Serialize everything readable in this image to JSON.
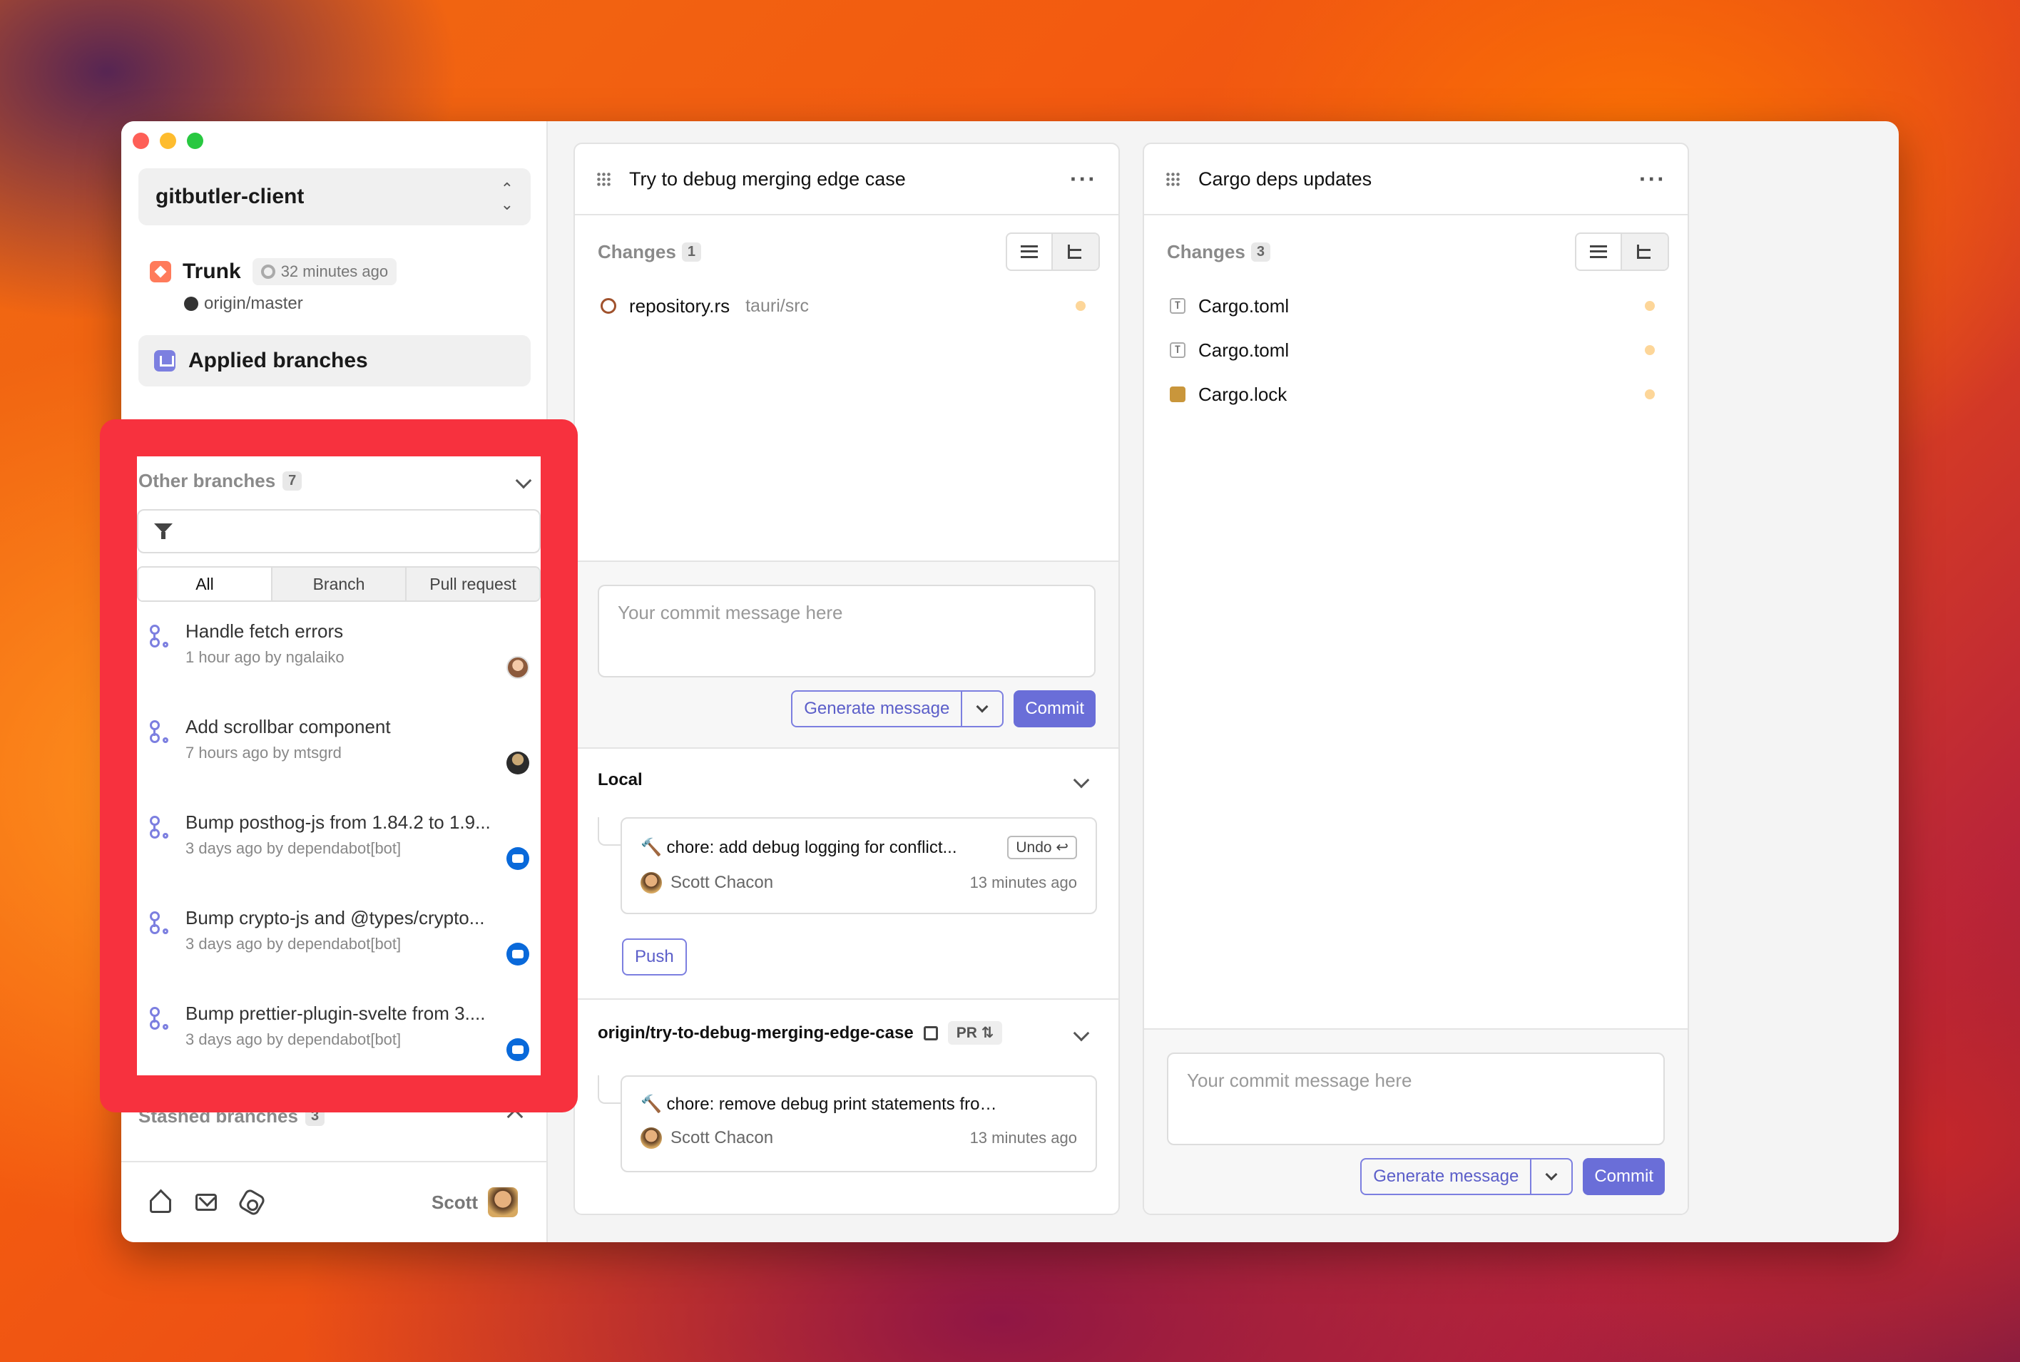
{
  "window": {
    "project_name": "gitbutler-client"
  },
  "sidebar": {
    "trunk": {
      "label": "Trunk",
      "time": "32 minutes ago",
      "remote": "origin/master"
    },
    "applied_label": "Applied branches",
    "other_branches": {
      "title": "Other branches",
      "count": "7",
      "filter_placeholder": "",
      "tabs": [
        "All",
        "Branch",
        "Pull request"
      ],
      "active_tab": "All",
      "items": [
        {
          "title": "Handle fetch errors",
          "subtitle": "1 hour ago by ngalaiko",
          "avatar": "person"
        },
        {
          "title": "Add scrollbar component",
          "subtitle": "7 hours ago by mtsgrd",
          "avatar": "dark"
        },
        {
          "title": "Bump posthog-js from 1.84.2 to 1.9...",
          "subtitle": "3 days ago by dependabot[bot]",
          "avatar": "bot"
        },
        {
          "title": "Bump crypto-js and @types/crypto...",
          "subtitle": "3 days ago by dependabot[bot]",
          "avatar": "bot"
        },
        {
          "title": "Bump prettier-plugin-svelte from 3....",
          "subtitle": "3 days ago by dependabot[bot]",
          "avatar": "bot"
        }
      ]
    },
    "stashed": {
      "title": "Stashed branches",
      "count": "3"
    },
    "footer": {
      "user_name": "Scott"
    }
  },
  "lanes": [
    {
      "title": "Try to debug merging edge case",
      "changes_label": "Changes",
      "changes_count": "1",
      "files": [
        {
          "name": "repository.rs",
          "path": "tauri/src",
          "icon": "rust"
        }
      ],
      "commit_placeholder": "Your commit message here",
      "generate_label": "Generate message",
      "commit_label": "Commit",
      "local": {
        "title": "Local",
        "commit_message": "🔨 chore: add debug logging for conflict...",
        "undo_label": "Undo ↩",
        "author": "Scott Chacon",
        "time": "13 minutes ago",
        "push_label": "Push"
      },
      "remote": {
        "title": "origin/try-to-debug-merging-edge-case",
        "pr_label": "PR ⇅",
        "commit_message": "🔨 chore: remove debug print statements from wor...",
        "author": "Scott Chacon",
        "time": "13 minutes ago"
      }
    },
    {
      "title": "Cargo deps updates",
      "changes_label": "Changes",
      "changes_count": "3",
      "files": [
        {
          "name": "Cargo.toml",
          "path": "",
          "icon": "toml"
        },
        {
          "name": "Cargo.toml",
          "path": "",
          "icon": "toml"
        },
        {
          "name": "Cargo.lock",
          "path": "",
          "icon": "lock"
        }
      ],
      "commit_placeholder": "Your commit message here",
      "generate_label": "Generate message",
      "commit_label": "Commit"
    }
  ],
  "colors": {
    "accent": "#6a6ed8",
    "highlight": "#f7313e",
    "modified_dot": "#fdd699"
  },
  "icons": {
    "toml_glyph": "T"
  }
}
